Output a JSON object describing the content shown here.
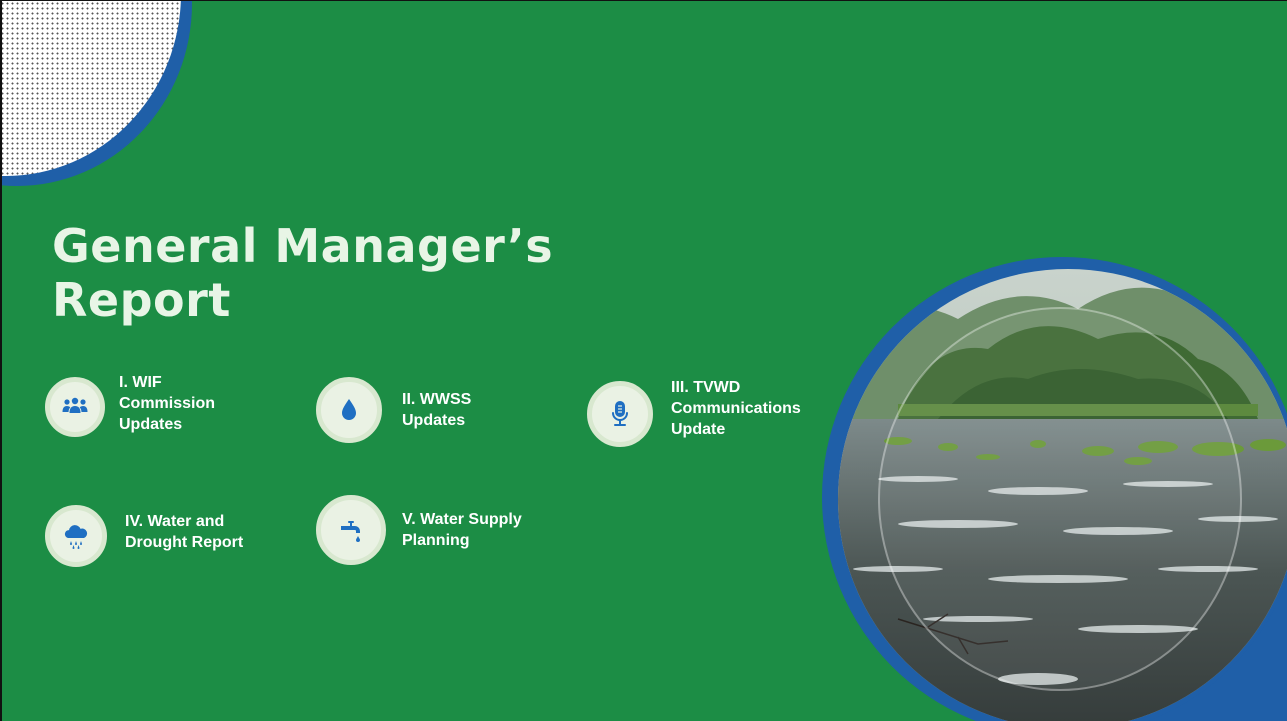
{
  "slide": {
    "title_line1": "General Manager’s",
    "title_line2": "Report"
  },
  "agenda": [
    {
      "label": "I. WIF\nCommission\nUpdates",
      "icon": "people-group-icon"
    },
    {
      "label": "II. WWSS\nUpdates",
      "icon": "water-drop-icon"
    },
    {
      "label": "III. TVWD\nCommunications\nUpdate",
      "icon": "microphone-icon"
    },
    {
      "label": "IV. Water and\nDrought Report",
      "icon": "rain-cloud-icon"
    },
    {
      "label": "V. Water Supply\nPlanning",
      "icon": "faucet-icon"
    }
  ],
  "colors": {
    "background": "#1c8d45",
    "accent_blue": "#1f5fa8",
    "title_text": "#e8f5e6",
    "icon_blue": "#1f6fc2"
  }
}
